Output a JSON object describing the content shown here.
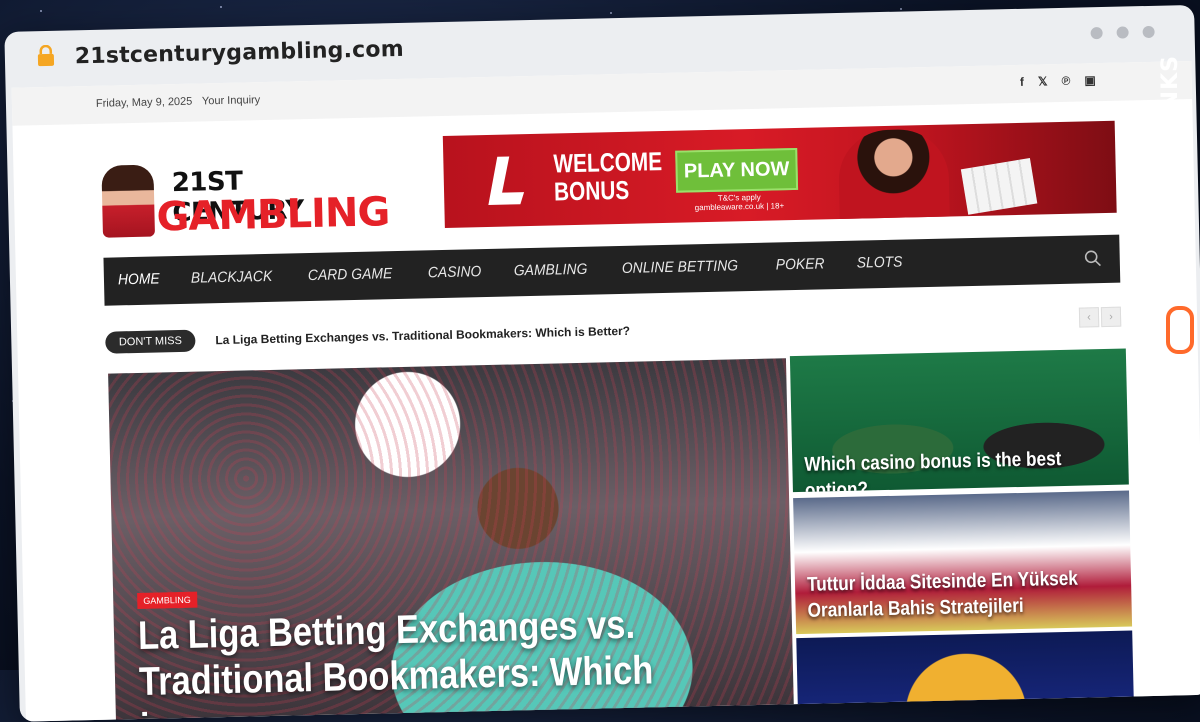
{
  "browser": {
    "url": "21stcenturygambling.com"
  },
  "topbar": {
    "date": "Friday, May 9, 2025",
    "inquiry": "Your Inquiry",
    "social_icons": [
      "facebook-icon",
      "twitter-icon",
      "pinterest-icon",
      "instagram-icon"
    ]
  },
  "logo": {
    "line1": "21ST CENTURY",
    "line2": "GAMBLING"
  },
  "banner": {
    "headline1": "WELCOME",
    "headline2": "BONUS",
    "cta": "PLAY NOW",
    "fineprint": "T&C's apply\ngambleaware.co.uk | 18+"
  },
  "nav": {
    "items": [
      "HOME",
      "BLACKJACK",
      "CARD GAME",
      "CASINO",
      "GAMBLING",
      "ONLINE BETTING",
      "POKER",
      "SLOTS"
    ]
  },
  "ticker": {
    "label": "DON'T MISS",
    "headline": "La Liga Betting Exchanges vs. Traditional Bookmakers: Which is Better?"
  },
  "hero": {
    "category": "GAMBLING",
    "title": "La Liga Betting Exchanges vs. Traditional Bookmakers: Which is"
  },
  "side_posts": [
    {
      "title": "Which casino bonus is the best option?"
    },
    {
      "title": "Tuttur İddaa Sitesinde En Yüksek Oranlarla Bahis Stratejileri"
    },
    {
      "title": ""
    }
  ],
  "watermark": {
    "text": "GUESTPOSTLINKS"
  },
  "colors": {
    "accent": "#e52128",
    "nav_bg": "#222222",
    "watermark": "#ff6a2b"
  }
}
